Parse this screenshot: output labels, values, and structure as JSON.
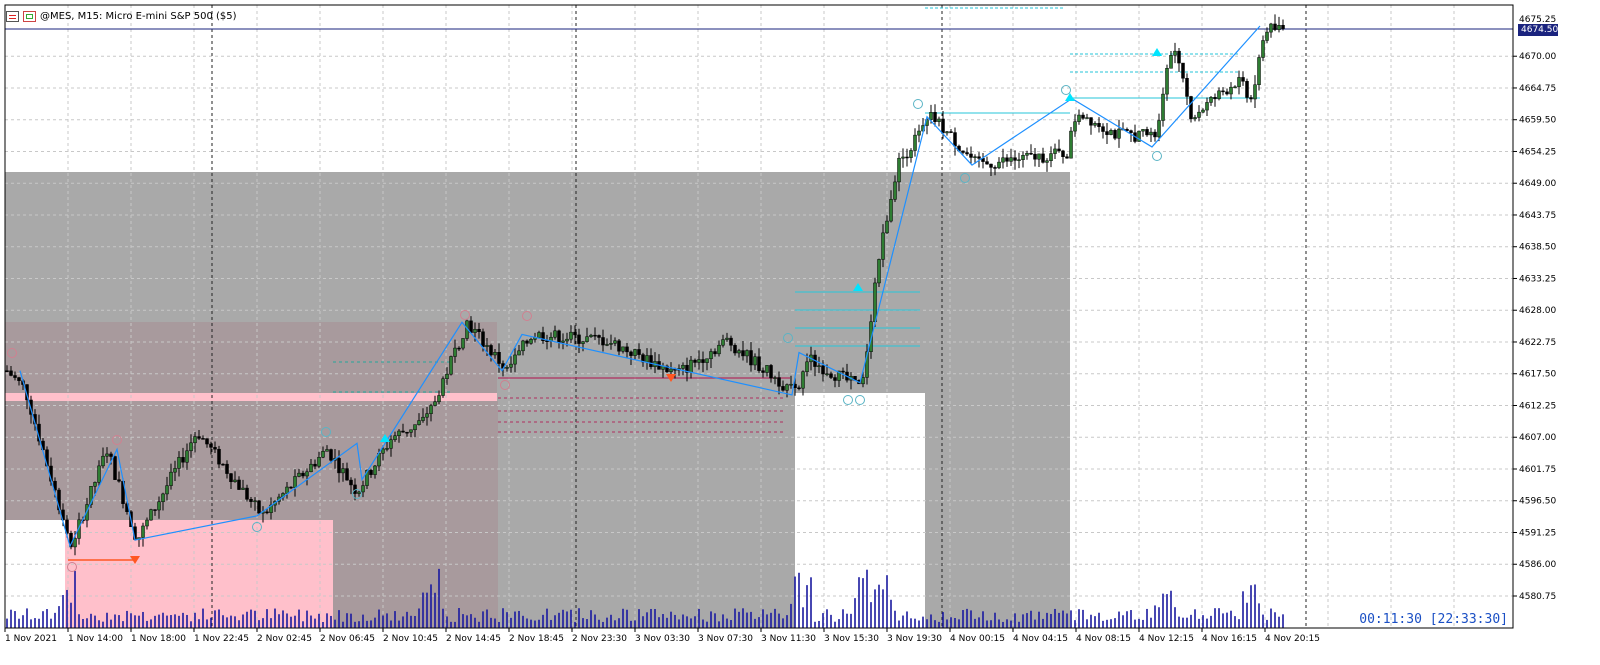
{
  "header": {
    "symbol_title": "@MES, M15:  Micro E-mini S&P 500 ($5)",
    "icons": [
      "chart-window-icon",
      "indicator-icon"
    ]
  },
  "price_axis": {
    "labels": [
      "4670.00",
      "4664.75",
      "4659.50",
      "4654.25",
      "4649.00",
      "4643.75",
      "4638.50",
      "4633.25",
      "4628.00",
      "4622.75",
      "4617.50",
      "4612.25",
      "4607.00",
      "4601.75",
      "4596.50",
      "4591.25",
      "4586.00",
      "4580.75"
    ],
    "current_price": "4674.50",
    "top_partial": "4675.25"
  },
  "time_axis": {
    "labels": [
      "1 Nov 2021",
      "1 Nov 14:00",
      "1 Nov 18:00",
      "1 Nov 22:45",
      "2 Nov 02:45",
      "2 Nov 06:45",
      "2 Nov 10:45",
      "2 Nov 14:45",
      "2 Nov 18:45",
      "2 Nov 23:30",
      "3 Nov 03:30",
      "3 Nov 07:30",
      "3 Nov 11:30",
      "3 Nov 15:30",
      "3 Nov 19:30",
      "4 Nov 00:15",
      "4 Nov 04:15",
      "4 Nov 08:15",
      "4 Nov 12:15",
      "4 Nov 16:15",
      "4 Nov 20:15"
    ]
  },
  "timer": "00:11:30 [22:33:30]",
  "colors": {
    "grid": "#c8c8c8",
    "zone_gray": "#a9a9a9",
    "zone_pink": "#ffc0cb",
    "zone_overlap": "#a89a9d",
    "zigzag": "#1e90ff",
    "volume": "#1a1aa0",
    "bull_candle": "#2e7d32",
    "bear_candle": "#000000",
    "current_price_line": "#1a237e",
    "timer": "#1a4fc4"
  },
  "chart_data": {
    "type": "candlestick",
    "symbol": "@MES",
    "timeframe": "M15",
    "ylim": [
      4578,
      4677
    ],
    "anchors": [
      {
        "t": 0,
        "p": 4618.0
      },
      {
        "t": 18,
        "p": 4615.0
      },
      {
        "t": 64,
        "p": 4589.0
      },
      {
        "t": 100,
        "p": 4605.0
      },
      {
        "t": 130,
        "p": 4590.0
      },
      {
        "t": 190,
        "p": 4608.0
      },
      {
        "t": 255,
        "p": 4594.0
      },
      {
        "t": 320,
        "p": 4605.0
      },
      {
        "t": 350,
        "p": 4598.0
      },
      {
        "t": 385,
        "p": 4607.0
      },
      {
        "t": 420,
        "p": 4610.0
      },
      {
        "t": 460,
        "p": 4626.0
      },
      {
        "t": 500,
        "p": 4618.0
      },
      {
        "t": 525,
        "p": 4624.0
      },
      {
        "t": 600,
        "p": 4623.0
      },
      {
        "t": 670,
        "p": 4617.5
      },
      {
        "t": 720,
        "p": 4623.0
      },
      {
        "t": 790,
        "p": 4614.0
      },
      {
        "t": 800,
        "p": 4620.0
      },
      {
        "t": 855,
        "p": 4615.0
      },
      {
        "t": 870,
        "p": 4635.0
      },
      {
        "t": 890,
        "p": 4652.0
      },
      {
        "t": 925,
        "p": 4660.0
      },
      {
        "t": 970,
        "p": 4652.0
      },
      {
        "t": 1060,
        "p": 4654.0
      },
      {
        "t": 1070,
        "p": 4661.0
      },
      {
        "t": 1110,
        "p": 4657.0
      },
      {
        "t": 1150,
        "p": 4657.0
      },
      {
        "t": 1165,
        "p": 4672.0
      },
      {
        "t": 1185,
        "p": 4660.0
      },
      {
        "t": 1230,
        "p": 4666.0
      },
      {
        "t": 1245,
        "p": 4663.0
      },
      {
        "t": 1258,
        "p": 4674.5
      },
      {
        "t": 1282,
        "p": 4674.5
      }
    ],
    "zigzag": [
      [
        68,
        4589
      ],
      [
        18,
        4618
      ],
      [
        68,
        4589
      ],
      [
        115,
        4605
      ],
      [
        133,
        4590
      ],
      [
        255,
        4594
      ],
      [
        355,
        4606
      ],
      [
        360,
        4600
      ],
      [
        460,
        4626
      ],
      [
        500,
        4618
      ],
      [
        520,
        4624
      ],
      [
        790,
        4614
      ],
      [
        797,
        4621
      ],
      [
        858,
        4616
      ],
      [
        925,
        4660
      ],
      [
        970,
        4652
      ],
      [
        1070,
        4663
      ],
      [
        1150,
        4655
      ],
      [
        1258,
        4675
      ]
    ],
    "volume_bars": true,
    "current_price": 4674.5
  }
}
